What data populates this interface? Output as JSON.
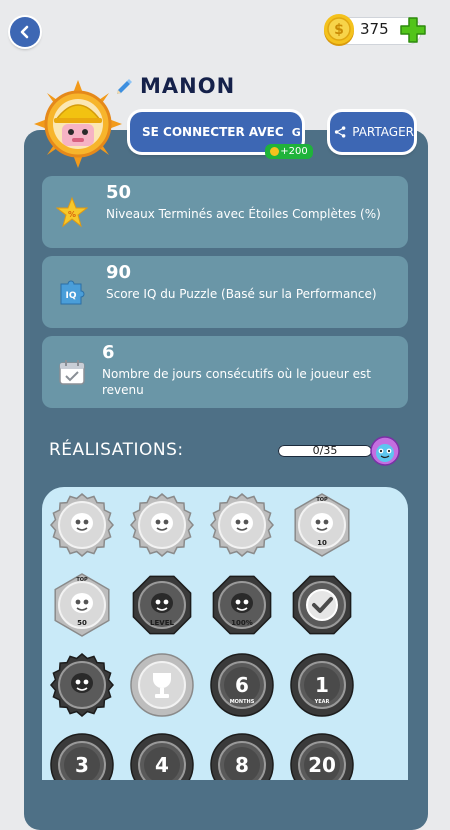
{
  "header": {
    "coins": "375"
  },
  "profile": {
    "name": "MANON",
    "connect_label": "SE CONNECTER AVEC",
    "connect_provider": "G",
    "connect_reward": "+200",
    "share_label": "PARTAGER"
  },
  "stats": [
    {
      "value": "50",
      "description": "Niveaux Terminés avec Étoiles Complètes (%)",
      "icon": "star-percent-icon"
    },
    {
      "value": "90",
      "description": "Score IQ du Puzzle (Basé sur la Performance)",
      "icon": "iq-puzzle-icon"
    },
    {
      "value": "6",
      "description": "Nombre de jours consécutifs où le joueur est revenu",
      "icon": "calendar-icon"
    }
  ],
  "achievements": {
    "title": "RÉALISATIONS:",
    "progress": "0/35",
    "badges": [
      {
        "name": "badge-gear-1",
        "shape": "gear"
      },
      {
        "name": "badge-gear-2",
        "shape": "gear"
      },
      {
        "name": "badge-gear-3",
        "shape": "gear"
      },
      {
        "name": "badge-top-10",
        "shape": "hex",
        "text": "10",
        "top": "TOP"
      },
      {
        "name": "badge-top-50",
        "shape": "hex",
        "text": "50",
        "top": "TOP"
      },
      {
        "name": "badge-level",
        "shape": "octagon",
        "text": "LEVEL"
      },
      {
        "name": "badge-100-percent",
        "shape": "octagon",
        "text": "100%"
      },
      {
        "name": "badge-check",
        "shape": "check"
      },
      {
        "name": "badge-cap",
        "shape": "cap"
      },
      {
        "name": "badge-trophy",
        "shape": "trophy"
      },
      {
        "name": "badge-6-months",
        "shape": "round",
        "text": "6",
        "sub": "MONTHS"
      },
      {
        "name": "badge-1-year",
        "shape": "round",
        "text": "1",
        "sub": "YEAR"
      },
      {
        "name": "badge-row4-1",
        "shape": "round",
        "text": "3"
      },
      {
        "name": "badge-row4-2",
        "shape": "round",
        "text": "4"
      },
      {
        "name": "badge-row4-3",
        "shape": "round",
        "text": "8"
      },
      {
        "name": "badge-row4-4",
        "shape": "round",
        "text": "20"
      }
    ]
  },
  "colors": {
    "accent_blue": "#3d67b4",
    "panel": "#4e7086",
    "card": "#6a96a7",
    "grid_bg": "#c9eaf8",
    "reward_green": "#1fb33a",
    "coin_gold": "#f4c21d",
    "plus_green": "#52c41a"
  }
}
